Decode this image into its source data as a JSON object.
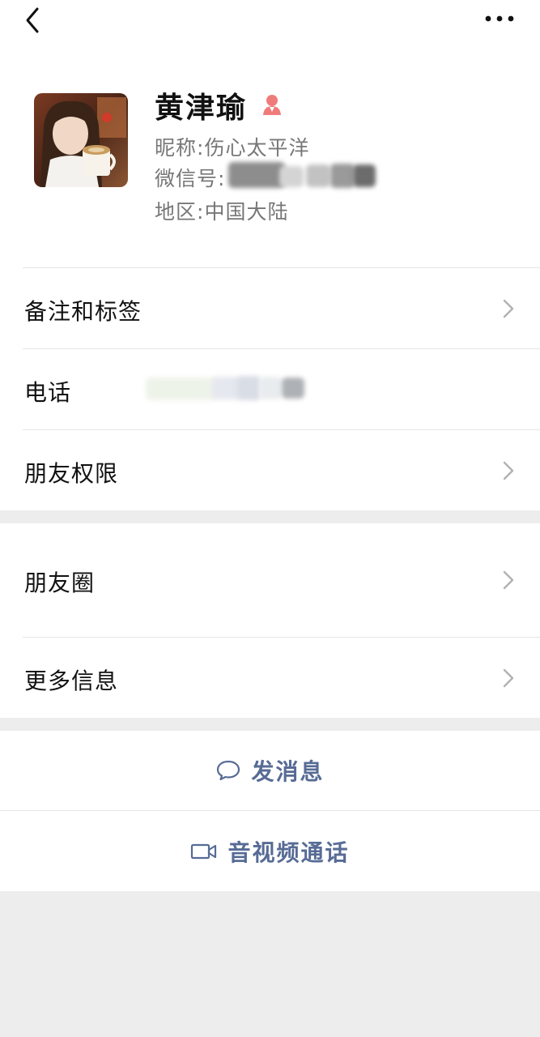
{
  "header": {
    "back_icon": "chevron-left-icon",
    "more_icon": "ellipsis-icon"
  },
  "profile": {
    "name": "黄津瑜",
    "gender_icon": "female-icon",
    "nickname_label": "昵称",
    "nickname": "伤心太平洋",
    "wechat_id_label": "微信号",
    "region_label": "地区",
    "region": "中国大陆",
    "avatar": "profile-photo"
  },
  "rows": {
    "remarks_tags": "备注和标签",
    "phone": "电话",
    "friend_permissions": "朋友权限",
    "moments": "朋友圈",
    "more_info": "更多信息"
  },
  "actions": {
    "send_message": "发消息",
    "video_call": "音视频通话"
  },
  "colors": {
    "link_blue": "#576b95",
    "background_gray": "#ededed",
    "female_icon": "#f07b7b"
  }
}
